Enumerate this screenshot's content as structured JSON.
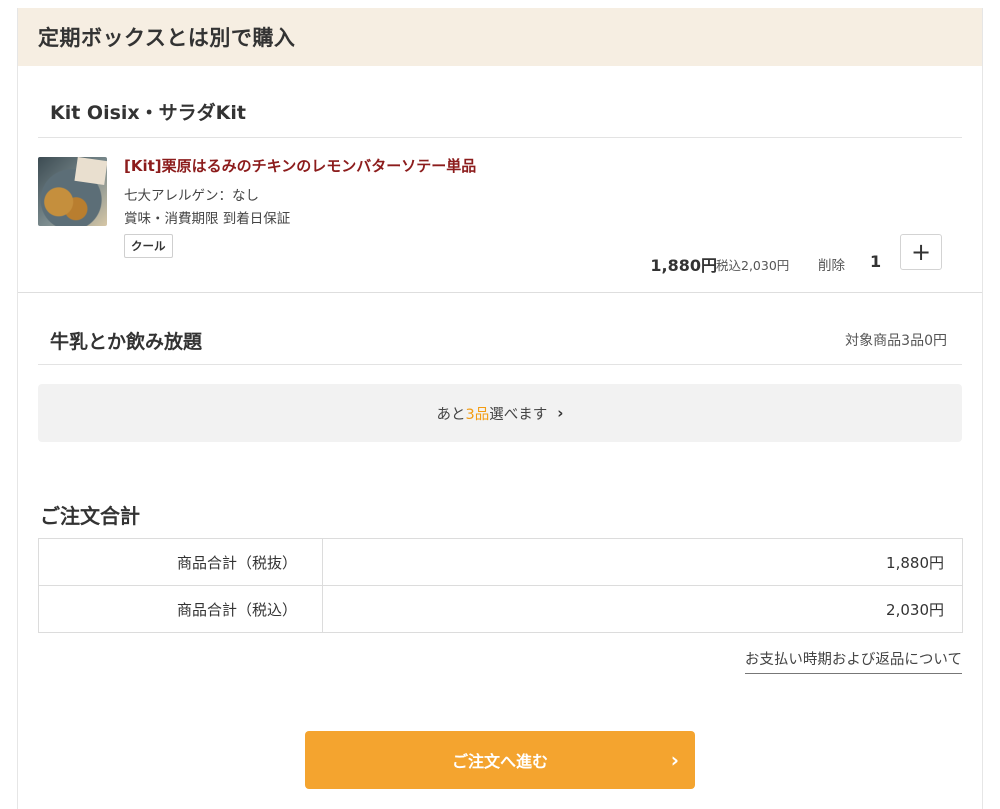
{
  "header": {
    "title": "定期ボックスとは別で購入"
  },
  "kit_section": {
    "title": "Kit Oisix・サラダKit",
    "product": {
      "name": "[Kit]栗原はるみのチキンのレモンバターソテー単品",
      "allergen": "七大アレルゲン：なし",
      "expiry": "賞味・消費期限 到着日保証",
      "badge": "クール",
      "price": "1,880円",
      "price_tax": "税込2,030円",
      "delete_label": "削除",
      "quantity": "1",
      "plus_label": "+"
    }
  },
  "milk_section": {
    "title": "牛乳とか飲み放題",
    "note": "対象商品3品0円",
    "choose_prefix": "あと",
    "choose_highlight": "3品",
    "choose_suffix": "選べます",
    "choose_arrow": "›",
    "highlight_color": "#f39c12"
  },
  "total": {
    "title": "ご注文合計",
    "rows": [
      {
        "label": "商品合計（税抜）",
        "value": "1,880円"
      },
      {
        "label": "商品合計（税込）",
        "value": "2,030円"
      }
    ],
    "payment_link": "お支払い時期および返品について"
  },
  "cta": {
    "label": "ご注文へ進む",
    "arrow": "›",
    "color": "#f4a42f"
  },
  "colors": {
    "header_bg": "#f6eee2",
    "product_name": "#8c1c1c"
  }
}
